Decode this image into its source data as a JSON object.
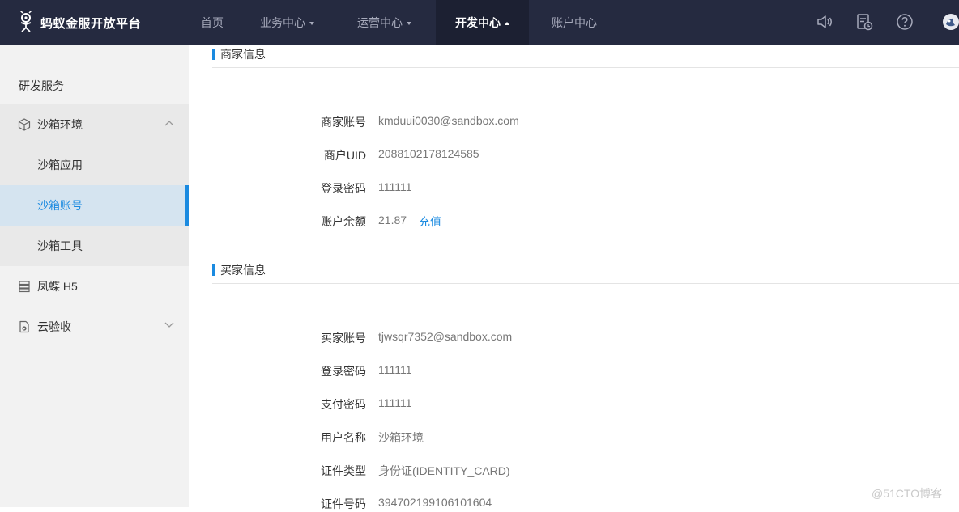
{
  "header": {
    "brand": "蚂蚁金服开放平台",
    "nav": [
      {
        "label": "首页",
        "dropdown": false
      },
      {
        "label": "业务中心",
        "dropdown": true
      },
      {
        "label": "运营中心",
        "dropdown": true
      },
      {
        "label": "开发中心",
        "dropdown": true,
        "active": true
      },
      {
        "label": "账户中心",
        "dropdown": false
      }
    ],
    "icons": [
      "volume-icon",
      "notice-list-icon",
      "help-icon",
      "avatar"
    ]
  },
  "sidebar": {
    "heading": "研发服务",
    "sandbox_group": "沙箱环境",
    "sandbox_items": [
      "沙箱应用",
      "沙箱账号",
      "沙箱工具"
    ],
    "selected": "沙箱账号",
    "fengdie": "凤蝶 H5",
    "cloud_check": "云验收"
  },
  "merchant": {
    "title": "商家信息",
    "rows": [
      {
        "label": "商家账号",
        "value": "kmduui0030@sandbox.com"
      },
      {
        "label": "商户UID",
        "value": "2088102178124585"
      },
      {
        "label": "登录密码",
        "value": "111111"
      },
      {
        "label": "账户余额",
        "value": "21.87"
      }
    ],
    "recharge_link": "充值"
  },
  "buyer": {
    "title": "买家信息",
    "rows": [
      {
        "label": "买家账号",
        "value": "tjwsqr7352@sandbox.com"
      },
      {
        "label": "登录密码",
        "value": "111111"
      },
      {
        "label": "支付密码",
        "value": "111111"
      },
      {
        "label": "用户名称",
        "value": "沙箱环境"
      },
      {
        "label": "证件类型",
        "value": "身份证(IDENTITY_CARD)"
      },
      {
        "label": "证件号码",
        "value": "394702199106101604"
      }
    ]
  },
  "watermark": "@51CTO博客",
  "colors": {
    "nav_bg": "#252a40",
    "accent": "#1a8ae0",
    "sidebar_bg": "#f2f2f2"
  }
}
